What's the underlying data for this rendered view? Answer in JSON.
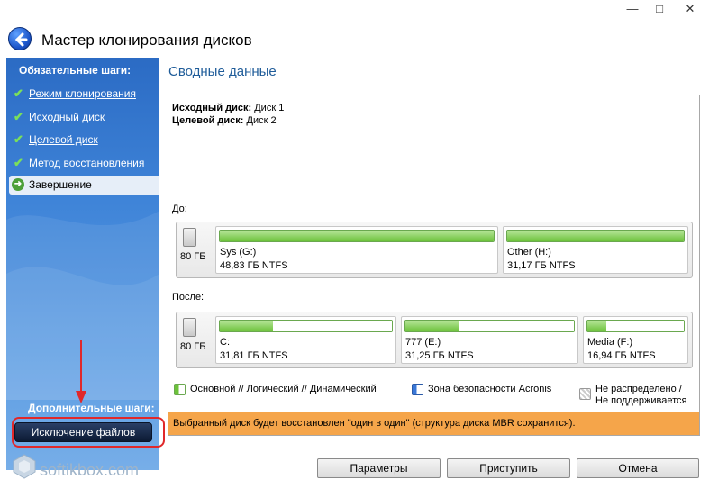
{
  "window": {
    "title": "Мастер клонирования дисков",
    "controls": [
      "—",
      "□",
      "✕"
    ]
  },
  "sidebar": {
    "required_heading": "Обязательные шаги:",
    "items": [
      {
        "label": "Режим клонирования",
        "state": "done"
      },
      {
        "label": "Исходный диск",
        "state": "done"
      },
      {
        "label": "Целевой диск",
        "state": "done"
      },
      {
        "label": "Метод восстановления",
        "state": "done"
      },
      {
        "label": "Завершение",
        "state": "active"
      }
    ],
    "optional_heading": "Дополнительные шаги:",
    "exclude_button": "Исключение файлов"
  },
  "main": {
    "title": "Сводные данные",
    "source_label": "Исходный диск:",
    "source_value": " Диск 1",
    "target_label": "Целевой диск:",
    "target_value": " Диск 2",
    "before_label": "До:",
    "after_label": "После:",
    "before": {
      "disk_size": "80 ГБ",
      "partitions": [
        {
          "name": "Sys (G:)",
          "info": "48,83 ГБ  NTFS",
          "used": 1.0
        },
        {
          "name": "Other (H:)",
          "info": "31,17 ГБ  NTFS",
          "used": 1.0
        }
      ]
    },
    "after": {
      "disk_size": "80 ГБ",
      "partitions": [
        {
          "name": "C:",
          "info": "31,81 ГБ  NTFS",
          "used": 0.31
        },
        {
          "name": "777 (E:)",
          "info": "31,25 ГБ  NTFS",
          "used": 0.32
        },
        {
          "name": "Media (F:)",
          "info": "16,94 ГБ  NTFS",
          "used": 0.2
        }
      ]
    },
    "legend": {
      "primary": "Основной // Логический // Динамический",
      "acronis": "Зона безопасности Acronis",
      "unallocated_1": "Не распределено /",
      "unallocated_2": "Не поддерживается"
    },
    "info_message": "Выбранный диск будет восстановлен \"один в один\" (структура диска MBR сохранится)."
  },
  "footer": {
    "params": "Параметры",
    "proceed": "Приступить",
    "cancel": "Отмена",
    "watermark": "softikbox.com"
  },
  "colors": {
    "accent": "#1f5c99",
    "partition_fill": "#6cc23a",
    "info_bar": "#f5a54a",
    "highlight": "#e0282a"
  }
}
